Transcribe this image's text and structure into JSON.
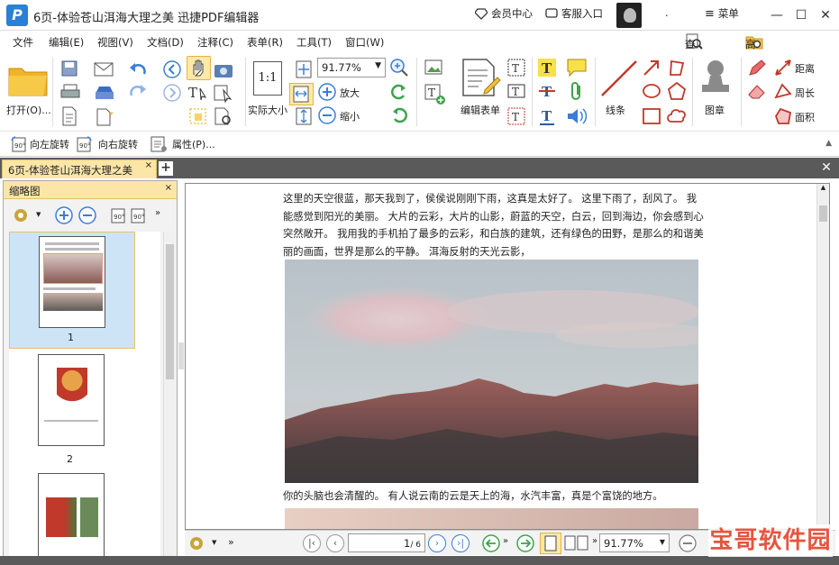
{
  "window": {
    "title": "6页-体验苍山洱海大理之美  迅捷PDF编辑器",
    "member_center": "会员中心",
    "customer_service": "客服入口",
    "dot": ".",
    "menu": "菜单"
  },
  "menubar": [
    "文件",
    "编辑(E)",
    "视图(V)",
    "文档(D)",
    "注释(C)",
    "表单(R)",
    "工具(T)",
    "窗口(W)"
  ],
  "search": {
    "find": "查找(F)",
    "advanced": "高级查找(S)"
  },
  "ribbon": {
    "open": "打开(O)...",
    "actual_size": "实际大小",
    "zoom_value": "91.77%",
    "zoom_in": "放大",
    "zoom_out": "缩小",
    "edit_form": "编辑表单",
    "line": "线条",
    "stamp": "图章",
    "distance": "距离",
    "perimeter": "周长",
    "area": "面积"
  },
  "toolbar2": {
    "rotate_left": "向左旋转",
    "rotate_right": "向右旋转",
    "properties": "属性(P)..."
  },
  "tab": {
    "label": "6页-体验苍山洱海大理之美"
  },
  "panel": {
    "title": "缩略图",
    "pages": [
      "1",
      "2"
    ]
  },
  "document": {
    "paragraph_top": [
      "这里的天空很蓝，那天我到了，侯侯说刚刚下雨，这真是太好了。 这里下雨了，刮风了。 我",
      "能感觉到阳光的美丽。 大片的云彩，大片的山影，蔚蓝的天空，白云，回到海边，你会感到心",
      "突然敞开。 我用我的手机拍了最多的云彩，和白族的建筑，还有绿色的田野，是那么的和谐美",
      "丽的画面，世界是那么的平静。 洱海反射的天光云影，"
    ],
    "paragraph_bottom": "你的头脑也会清醒的。 有人说云南的云是天上的海，水汽丰富，真是个富饶的地方。"
  },
  "status": {
    "page_current": "1",
    "page_total": "/ 6",
    "zoom": "91.77%"
  },
  "watermark": "宝哥软件园",
  "colors": {
    "accent_tab": "#fbe6a8",
    "dark_strip": "#5a5a5a",
    "logo_blue": "#2a7fd6"
  }
}
